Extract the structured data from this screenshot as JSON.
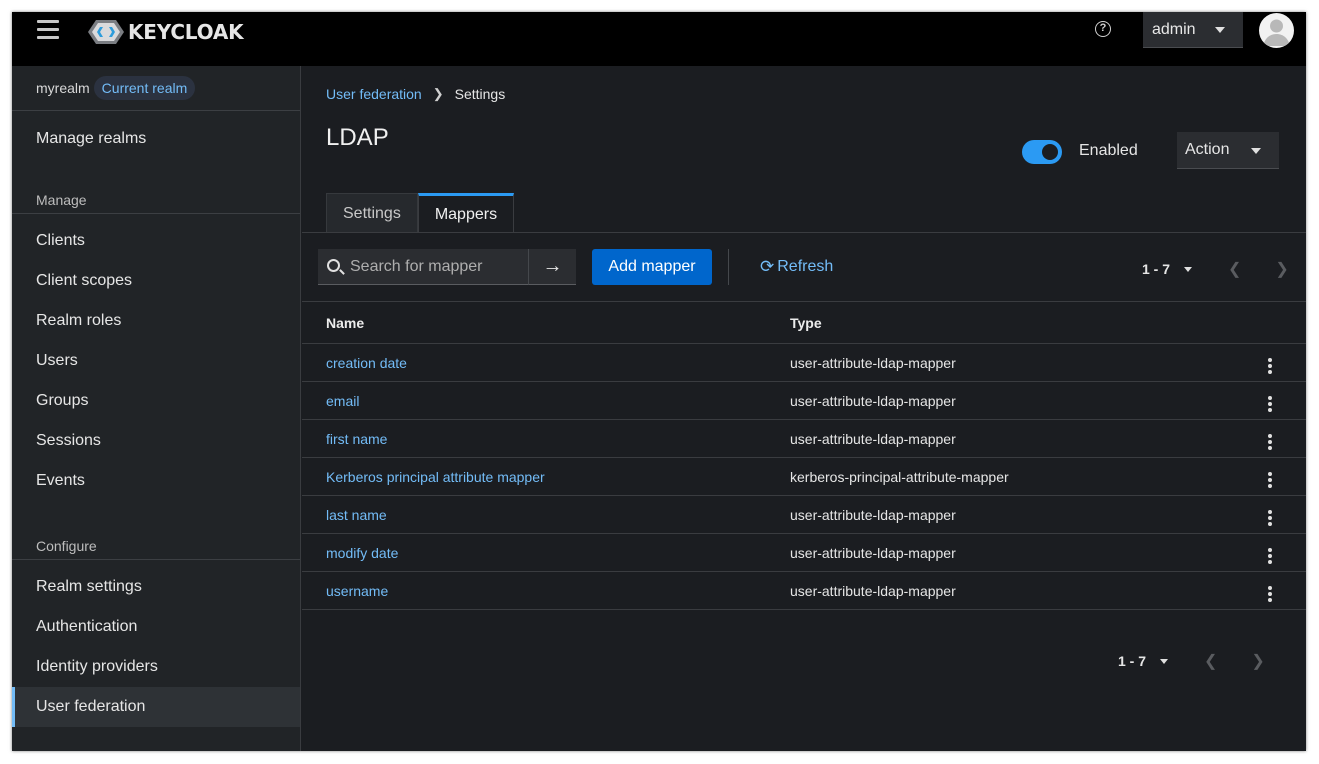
{
  "header": {
    "logo_text": "KEYCLOAK",
    "user_label": "admin"
  },
  "sidebar": {
    "realm_name": "myrealm",
    "realm_badge": "Current realm",
    "manage_realms": "Manage realms",
    "manage_heading": "Manage",
    "manage_items": [
      "Clients",
      "Client scopes",
      "Realm roles",
      "Users",
      "Groups",
      "Sessions",
      "Events"
    ],
    "configure_heading": "Configure",
    "configure_items": [
      "Realm settings",
      "Authentication",
      "Identity providers",
      "User federation"
    ]
  },
  "breadcrumb": {
    "parent": "User federation",
    "current": "Settings"
  },
  "page": {
    "title": "LDAP",
    "toggle_label": "Enabled",
    "toggle_on": true,
    "action_label": "Action"
  },
  "tabs": [
    "Settings",
    "Mappers"
  ],
  "active_tab": "Mappers",
  "toolbar": {
    "search_placeholder": "Search for mapper",
    "add_label": "Add mapper",
    "refresh_label": "Refresh",
    "pager_top": "1 - 7",
    "pager_bottom": "1 - 7"
  },
  "table": {
    "columns": [
      "Name",
      "Type"
    ],
    "rows": [
      {
        "name": "creation date",
        "type": "user-attribute-ldap-mapper"
      },
      {
        "name": "email",
        "type": "user-attribute-ldap-mapper"
      },
      {
        "name": "first name",
        "type": "user-attribute-ldap-mapper"
      },
      {
        "name": "Kerberos principal attribute mapper",
        "type": "kerberos-principal-attribute-mapper"
      },
      {
        "name": "last name",
        "type": "user-attribute-ldap-mapper"
      },
      {
        "name": "modify date",
        "type": "user-attribute-ldap-mapper"
      },
      {
        "name": "username",
        "type": "user-attribute-ldap-mapper"
      }
    ]
  },
  "colors": {
    "accent": "#73bcf7",
    "primary": "#0066cc",
    "toggle": "#2b9af3"
  },
  "icons": [
    "hamburger-icon",
    "keycloak-logo-icon",
    "help-icon",
    "chevron-down-icon",
    "avatar-icon",
    "search-icon",
    "arrow-right-icon",
    "refresh-icon",
    "angle-left-icon",
    "angle-right-icon",
    "kebab-icon"
  ]
}
